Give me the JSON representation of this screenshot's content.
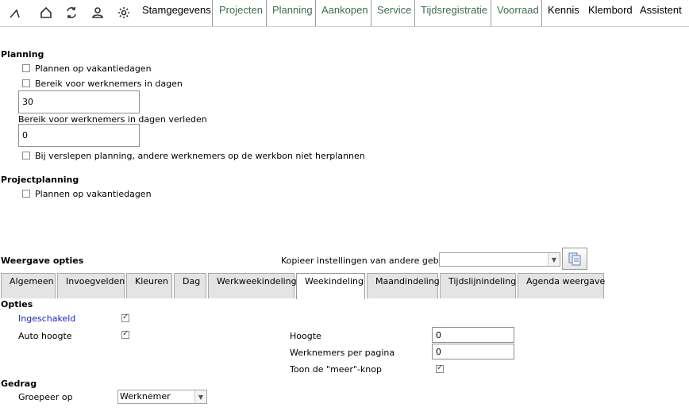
{
  "nav": {
    "icons": [
      "logo-icon",
      "home-icon",
      "refresh-icon",
      "user-icon",
      "gear-icon"
    ],
    "items": [
      {
        "label": "Stamgegevens",
        "color": "#000"
      },
      {
        "label": "Projecten",
        "color": "#3f6b4f"
      },
      {
        "label": "Planning",
        "color": "#3f6b4f"
      },
      {
        "label": "Aankopen",
        "color": "#3f6b4f"
      },
      {
        "label": "Service",
        "color": "#3f6b4f"
      },
      {
        "label": "Tijdsregistratie",
        "color": "#3f6b4f"
      },
      {
        "label": "Voorraad",
        "color": "#3f6b4f"
      },
      {
        "label": "Kennis",
        "color": "#000"
      },
      {
        "label": "Klembord",
        "color": "#000"
      },
      {
        "label": "Assistent",
        "color": "#000"
      }
    ]
  },
  "planning": {
    "title": "Planning",
    "vacation_label": "Plannen op vakantiedagen",
    "vacation_checked": false,
    "range_label": "Bereik voor werknemers in dagen",
    "range_checked": false,
    "range_value": "30",
    "past_label": "Bereik voor werknemers in dagen verleden",
    "past_value": "0",
    "drag_label": "Bij verslepen planning, andere werknemers op de werkbon niet herplannen",
    "drag_checked": false
  },
  "projectplanning": {
    "title": "Projectplanning",
    "vacation_label": "Plannen op vakantiedagen",
    "vacation_checked": false
  },
  "weergave": {
    "title": "Weergave opties",
    "copy_label": "Kopieer instellingen van andere gebruiker",
    "copy_value": ""
  },
  "tabs": [
    {
      "label": "Algemeen",
      "active": false
    },
    {
      "label": "Invoegvelden",
      "active": false
    },
    {
      "label": "Kleuren",
      "active": false
    },
    {
      "label": "Dag",
      "active": false
    },
    {
      "label": "Werkweekindeling",
      "active": false
    },
    {
      "label": "Weekindeling",
      "active": true
    },
    {
      "label": "Maandindeling",
      "active": false
    },
    {
      "label": "Tijdslijnindeling",
      "active": false
    },
    {
      "label": "Agenda weergave",
      "active": false
    }
  ],
  "opties": {
    "title": "Opties",
    "enabled_label": "Ingeschakeld",
    "enabled_checked": true,
    "autoheight_label": "Auto hoogte",
    "autoheight_checked": true,
    "height_label": "Hoogte",
    "height_value": "0",
    "perpage_label": "Werknemers per pagina",
    "perpage_value": "0",
    "more_label": "Toon de \"meer\"-knop",
    "more_checked": true
  },
  "gedrag": {
    "title": "Gedrag",
    "group_label": "Groepeer op",
    "group_value": "Werknemer"
  }
}
